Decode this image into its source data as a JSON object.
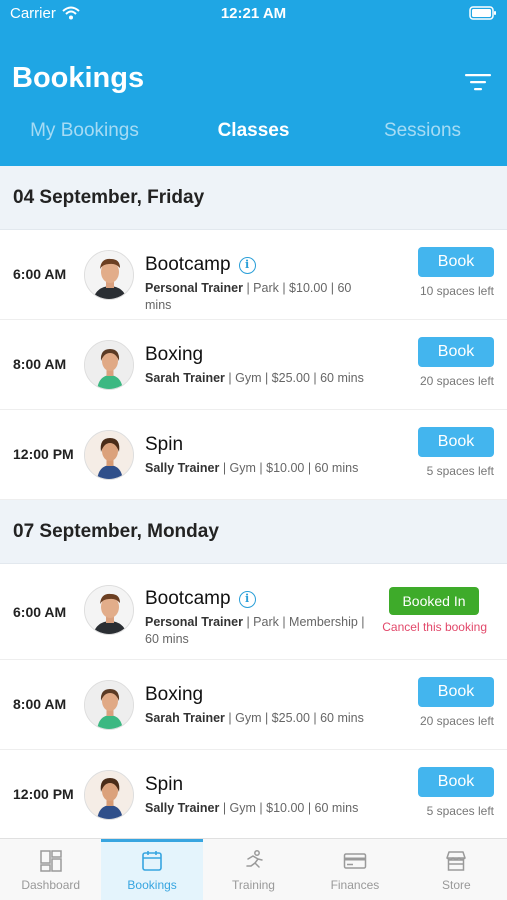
{
  "status_bar": {
    "carrier": "Carrier",
    "time": "12:21 AM"
  },
  "header": {
    "title": "Bookings",
    "tabs": [
      {
        "label": "My Bookings",
        "active": false
      },
      {
        "label": "Classes",
        "active": true
      },
      {
        "label": "Sessions",
        "active": false
      }
    ]
  },
  "colors": {
    "brand": "#1fa6e4",
    "book_button": "#43b5ee",
    "booked_in": "#3eab2a",
    "cancel_link": "#e2486a"
  },
  "days": [
    {
      "date": "04 September, Friday",
      "classes": [
        {
          "time": "6:00 AM",
          "title": "Bootcamp",
          "has_info": true,
          "trainer": "Personal Trainer",
          "details": " | Park | $10.00 | 60 mins",
          "button": "Book",
          "spaces": "10 spaces left"
        },
        {
          "time": "8:00 AM",
          "title": "Boxing",
          "has_info": false,
          "trainer": "Sarah Trainer",
          "details": " | Gym | $25.00 | 60 mins",
          "button": "Book",
          "spaces": "20 spaces left"
        },
        {
          "time": "12:00 PM",
          "title": "Spin",
          "has_info": false,
          "trainer": "Sally Trainer",
          "details": " | Gym | $10.00 | 60 mins",
          "button": "Book",
          "spaces": "5 spaces left"
        }
      ]
    },
    {
      "date": "07 September, Monday",
      "classes": [
        {
          "time": "6:00 AM",
          "title": "Bootcamp",
          "has_info": true,
          "trainer": "Personal Trainer",
          "details": " | Park | Membership | 60 mins",
          "button": "Booked In",
          "cancel": "Cancel this booking"
        },
        {
          "time": "8:00 AM",
          "title": "Boxing",
          "has_info": false,
          "trainer": "Sarah Trainer",
          "details": " | Gym | $25.00 | 60 mins",
          "button": "Book",
          "spaces": "20 spaces left"
        },
        {
          "time": "12:00 PM",
          "title": "Spin",
          "has_info": false,
          "trainer": "Sally Trainer",
          "details": " | Gym | $10.00 | 60 mins",
          "button": "Book",
          "spaces": "5 spaces left"
        }
      ]
    }
  ],
  "bottom_nav": [
    {
      "label": "Dashboard",
      "icon": "dashboard-icon",
      "active": false
    },
    {
      "label": "Bookings",
      "icon": "calendar-icon",
      "active": true
    },
    {
      "label": "Training",
      "icon": "runner-icon",
      "active": false
    },
    {
      "label": "Finances",
      "icon": "credit-card-icon",
      "active": false
    },
    {
      "label": "Store",
      "icon": "store-icon",
      "active": false
    }
  ]
}
